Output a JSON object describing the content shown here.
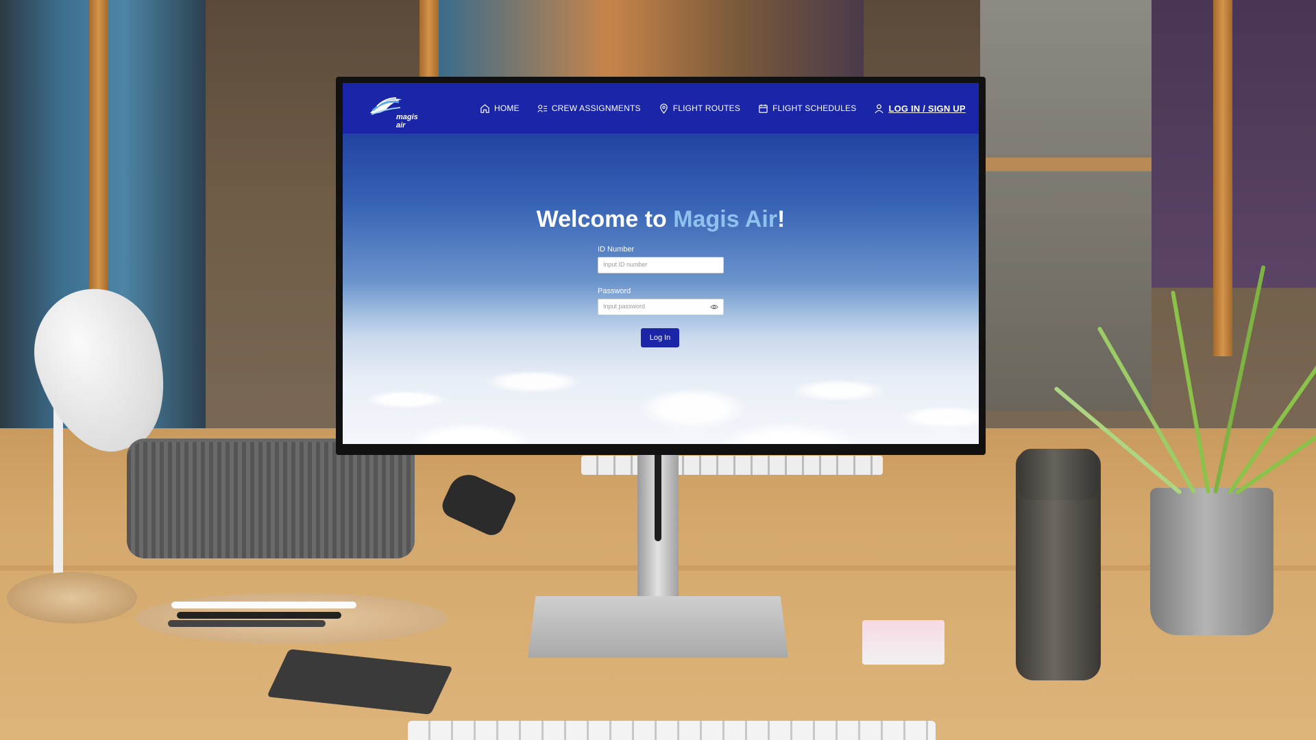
{
  "navbar": {
    "logo_text": "magis air",
    "items": [
      {
        "label": "HOME",
        "icon": "home-icon"
      },
      {
        "label": "CREW ASSIGNMENTS",
        "icon": "crew-icon"
      },
      {
        "label": "FLIGHT ROUTES",
        "icon": "location-pin-icon"
      },
      {
        "label": "FLIGHT SCHEDULES",
        "icon": "calendar-icon"
      },
      {
        "label": "LOG IN / SIGN UP",
        "icon": "user-icon"
      }
    ]
  },
  "hero": {
    "welcome_prefix": "Welcome to ",
    "brand_name": "Magis Air",
    "welcome_suffix": "!"
  },
  "form": {
    "id_label": "ID Number",
    "id_placeholder": "Input ID number",
    "password_label": "Password",
    "password_placeholder": "Input password",
    "submit_label": "Log In"
  },
  "colors": {
    "navbar": "#1a25a8",
    "accent_text": "#8fc1ef",
    "button": "#1a25a8"
  }
}
